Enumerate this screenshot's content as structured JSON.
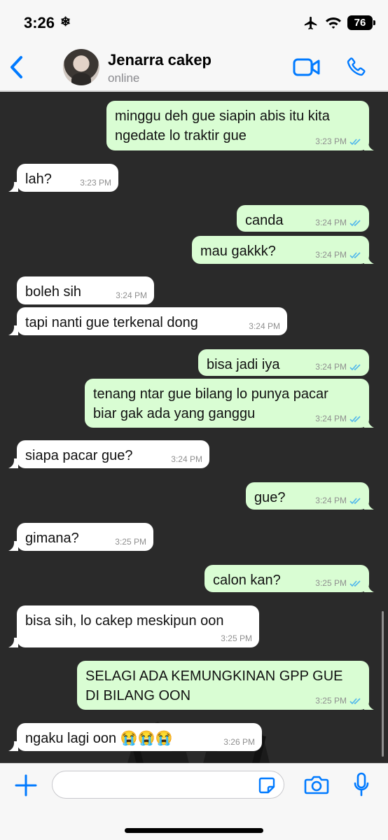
{
  "status_bar": {
    "time": "3:26",
    "battery": "76"
  },
  "header": {
    "back_icon": "chevron-left-icon",
    "contact_name": "Jenarra cakep",
    "contact_status": "online"
  },
  "colors": {
    "accent": "#007aff",
    "chat_bg": "#2a2a2a",
    "outgoing": "#d9fdd3",
    "incoming": "#ffffff",
    "read_tick": "#4fb6ec"
  },
  "messages": [
    {
      "dir": "out",
      "lines": [
        "minggu deh gue siapin abis itu kita",
        "ngedate lo traktir gue"
      ],
      "time": "3:23 PM",
      "read": true
    },
    {
      "dir": "in",
      "lines": [
        "lah?"
      ],
      "time": "3:23 PM"
    },
    {
      "dir": "out",
      "lines": [
        "canda"
      ],
      "time": "3:24 PM",
      "read": true
    },
    {
      "dir": "out",
      "lines": [
        "mau gakkk?"
      ],
      "time": "3:24 PM",
      "read": true
    },
    {
      "dir": "in",
      "lines": [
        "boleh sih"
      ],
      "time": "3:24 PM"
    },
    {
      "dir": "in",
      "lines": [
        "tapi nanti gue terkenal dong"
      ],
      "time": "3:24 PM"
    },
    {
      "dir": "out",
      "lines": [
        "bisa jadi iya"
      ],
      "time": "3:24 PM",
      "read": true
    },
    {
      "dir": "out",
      "lines": [
        "tenang ntar gue bilang lo punya pacar",
        "biar gak ada yang ganggu"
      ],
      "time": "3:24 PM",
      "read": true
    },
    {
      "dir": "in",
      "lines": [
        "siapa pacar gue?"
      ],
      "time": "3:24 PM"
    },
    {
      "dir": "out",
      "lines": [
        "gue?"
      ],
      "time": "3:24 PM",
      "read": true
    },
    {
      "dir": "in",
      "lines": [
        "gimana?"
      ],
      "time": "3:25 PM"
    },
    {
      "dir": "out",
      "lines": [
        "calon kan?"
      ],
      "time": "3:25 PM",
      "read": true
    },
    {
      "dir": "in",
      "lines": [
        "bisa sih, lo cakep meskipun oon"
      ],
      "time": "3:25 PM"
    },
    {
      "dir": "out",
      "lines": [
        "SELAGI ADA KEMUNGKINAN GPP GUE",
        "DI BILANG OON"
      ],
      "time": "3:25 PM",
      "read": true
    },
    {
      "dir": "in",
      "lines": [
        "ngaku lagi oon 😭😭😭"
      ],
      "time": "3:26 PM"
    }
  ],
  "composer": {
    "placeholder": "",
    "value": ""
  },
  "icons": [
    "plus-icon",
    "sticker-icon",
    "camera-icon",
    "microphone-icon",
    "video-call-icon",
    "phone-call-icon"
  ]
}
